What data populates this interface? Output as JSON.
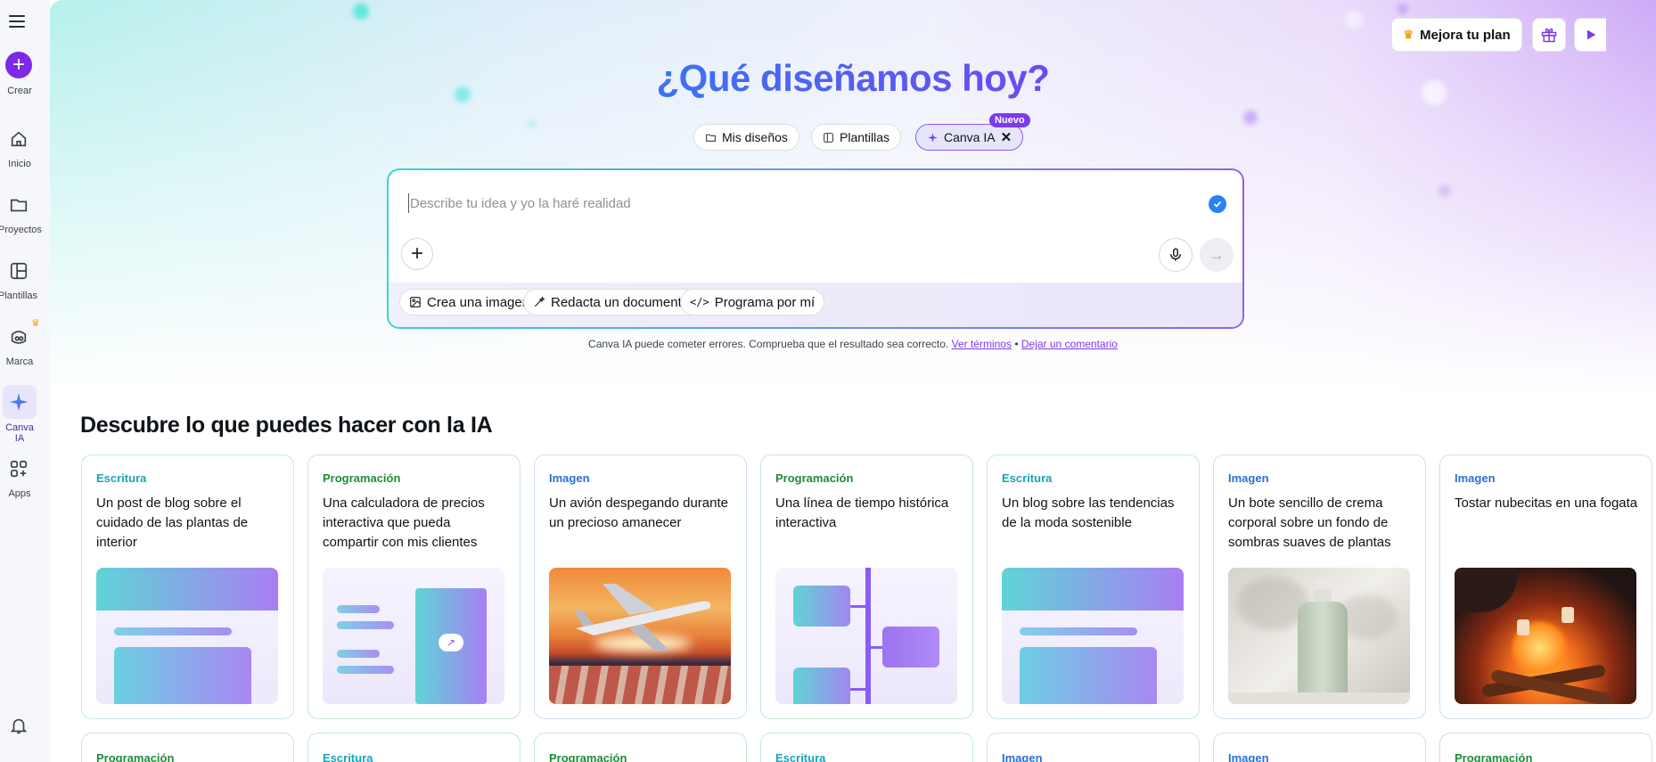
{
  "sidebar": {
    "create_label": "Crear",
    "items": [
      {
        "label": "Inicio",
        "icon": "home-icon"
      },
      {
        "label": "Proyectos",
        "icon": "folder-icon"
      },
      {
        "label": "Plantillas",
        "icon": "templates-icon"
      },
      {
        "label": "Marca",
        "icon": "brand-icon"
      },
      {
        "label": "Canva IA",
        "icon": "sparkle-icon"
      },
      {
        "label": "Apps",
        "icon": "apps-icon"
      }
    ]
  },
  "header": {
    "upgrade_label": "Mejora tu plan"
  },
  "hero": {
    "title": "¿Qué diseñamos hoy?",
    "tabs": [
      {
        "label": "Mis diseños"
      },
      {
        "label": "Plantillas"
      },
      {
        "label": "Canva IA"
      }
    ],
    "new_badge": "Nuevo"
  },
  "prompt": {
    "placeholder": "Describe tu idea y yo la haré realidad",
    "suggestions": [
      {
        "label": "Crea una imagen"
      },
      {
        "label": "Redacta un documento"
      },
      {
        "label": "Programa por mí"
      }
    ]
  },
  "disclaimer": {
    "text": "Canva IA puede cometer errores. Comprueba que el resultado sea correcto.",
    "terms_link": "Ver términos",
    "separator": "•",
    "feedback_link": "Dejar un comentario"
  },
  "section": {
    "title": "Descubre lo que puedes hacer con la IA"
  },
  "cards": [
    {
      "category": "Escritura",
      "description": "Un post de blog sobre el cuidado de las plantas de interior"
    },
    {
      "category": "Programación",
      "description": "Una calculadora de precios interactiva que pueda compartir con mis clientes"
    },
    {
      "category": "Imagen",
      "description": "Un avión despegando durante un precioso amanecer"
    },
    {
      "category": "Programación",
      "description": "Una línea de tiempo histórica interactiva"
    },
    {
      "category": "Escritura",
      "description": "Un blog sobre las tendencias de la moda sostenible"
    },
    {
      "category": "Imagen",
      "description": "Un bote sencillo de crema corporal sobre un fondo de sombras suaves de plantas"
    },
    {
      "category": "Imagen",
      "description": "Tostar nubecitas en una fogata"
    }
  ],
  "cards_row2": [
    {
      "category": "Programación"
    },
    {
      "category": "Escritura"
    },
    {
      "category": "Programación"
    },
    {
      "category": "Escritura"
    },
    {
      "category": "Imagen"
    },
    {
      "category": "Imagen"
    },
    {
      "category": "Programación"
    }
  ],
  "colors": {
    "accent": "#7c3aed",
    "escritura": "#1aa3b8",
    "programacion": "#1f8a3a",
    "imagen": "#2a6fd6"
  }
}
